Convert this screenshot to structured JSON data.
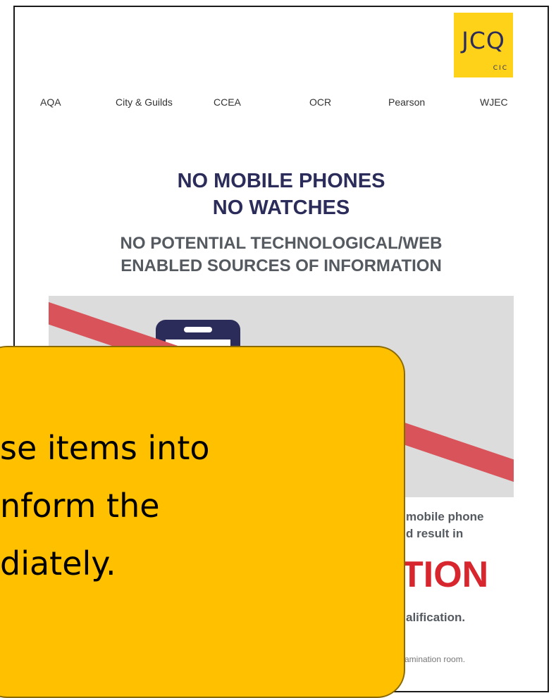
{
  "logo": {
    "main": "JCQ",
    "sub": "CIC"
  },
  "awarding_bodies": [
    "AQA",
    "City & Guilds",
    "CCEA",
    "OCR",
    "Pearson",
    "WJEC"
  ],
  "headline": {
    "line1": "NO MOBILE PHONES",
    "line2": "NO WATCHES"
  },
  "subhead": {
    "line1": "NO POTENTIAL TECHNOLOGICAL/WEB",
    "line2": "ENABLED SOURCES OF INFORMATION"
  },
  "warning": {
    "line1": "mobile phone",
    "line2": "d result in",
    "big": "TION",
    "line3": "alification.",
    "footer": "amination room."
  },
  "callout": {
    "line1": "se items into",
    "line2": "nform the",
    "line3": "diately."
  },
  "colors": {
    "navy": "#2b2c5a",
    "logo_yellow": "#ffd21a",
    "red": "#d7262e",
    "callout": "#ffc000",
    "grey_panel": "#dcdcdc"
  },
  "icons": {
    "graphic": "mobile-phone-icon",
    "strike": "prohibited-strike"
  }
}
